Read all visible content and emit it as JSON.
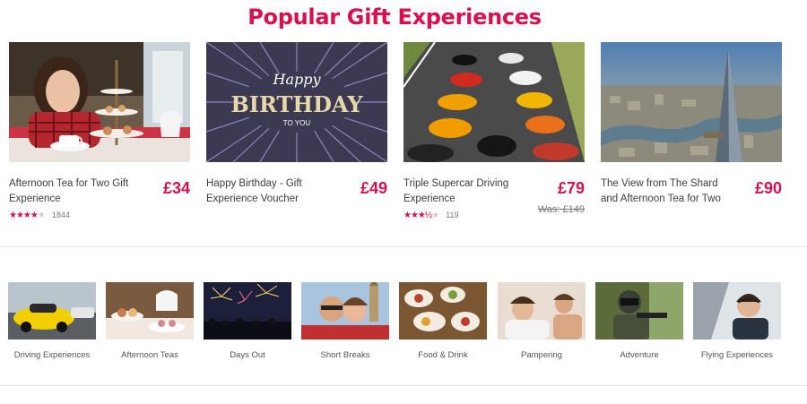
{
  "heading": "Popular Gift Experiences",
  "products": [
    {
      "name": "Afternoon Tea for Two Gift Experience",
      "price": "£34",
      "was": "",
      "stars": 4,
      "rating_count": "1844",
      "image": "woman-with-afternoon-tea-stand"
    },
    {
      "name": "Happy Birthday - Gift Experience Voucher",
      "price": "£49",
      "was": "",
      "stars": 0,
      "rating_count": "",
      "image": "happy-birthday-card",
      "card_script": "Happy",
      "card_main": "BIRTHDAY",
      "card_sub": "TO YOU"
    },
    {
      "name": "Triple Supercar Driving Experience",
      "price": "£79",
      "was": "Was: £149",
      "stars": 3.5,
      "rating_count": "119",
      "image": "supercars-on-track"
    },
    {
      "name": "The View from The Shard and Afternoon Tea for Two",
      "price": "£90",
      "was": "",
      "stars": 0,
      "rating_count": "",
      "image": "london-skyline-shard"
    }
  ],
  "categories": [
    {
      "label": "Driving Experiences",
      "image": "yellow-sports-car"
    },
    {
      "label": "Afternoon Teas",
      "image": "afternoon-tea-cakes"
    },
    {
      "label": "Days Out",
      "image": "fireworks-crowd"
    },
    {
      "label": "Short Breaks",
      "image": "couple-selfie-big-ben"
    },
    {
      "label": "Food & Drink",
      "image": "food-platters"
    },
    {
      "label": "Pampering",
      "image": "spa-massage-couple"
    },
    {
      "label": "Adventure",
      "image": "paintball-player"
    },
    {
      "label": "Flying Experiences",
      "image": "woman-in-cockpit"
    }
  ],
  "colors": {
    "brand": "#d8114e",
    "text": "#3d3d3d",
    "muted": "#777777"
  }
}
